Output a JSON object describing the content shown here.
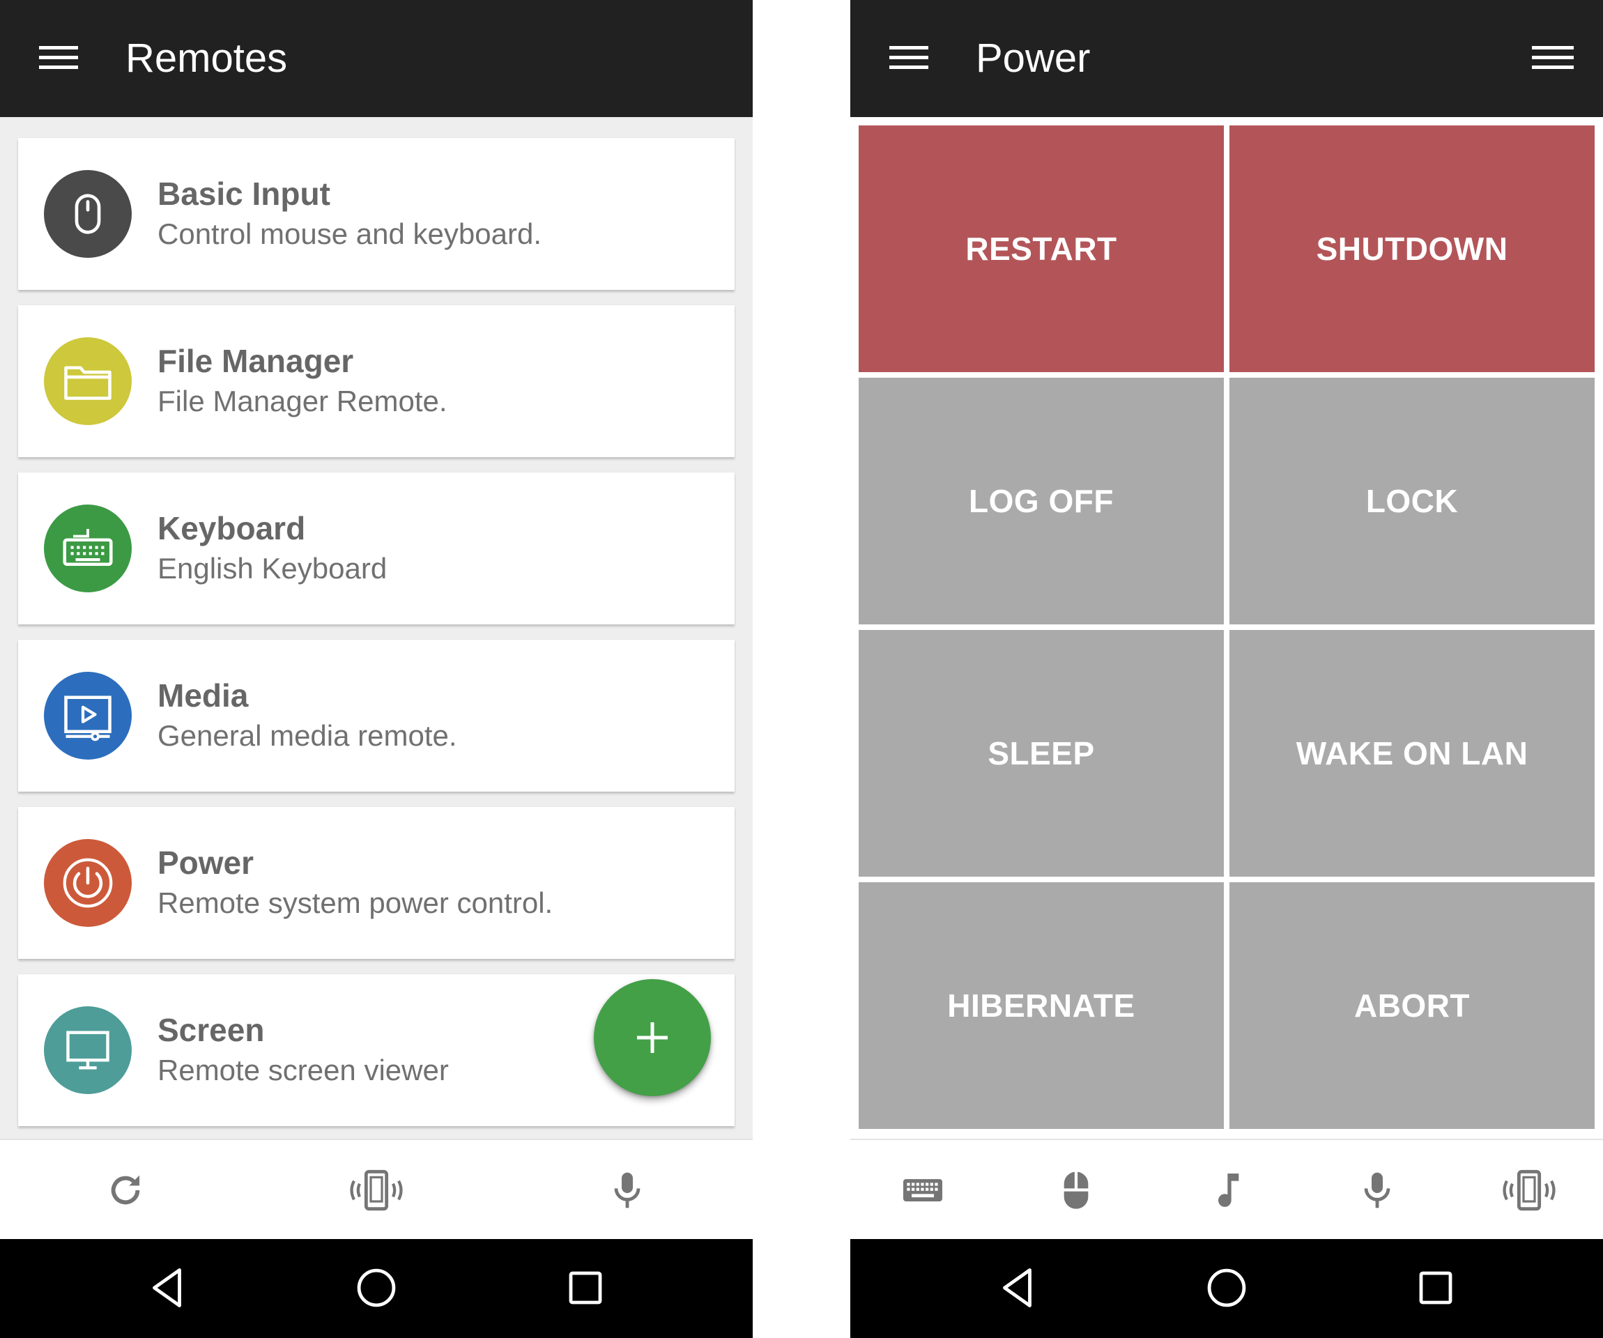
{
  "left": {
    "title": "Remotes",
    "remotes": [
      {
        "name": "Basic Input",
        "description": "Control mouse and keyboard.",
        "icon": "mouse-icon",
        "color": "#4a4a4a"
      },
      {
        "name": "File Manager",
        "description": "File Manager Remote.",
        "icon": "folder-icon",
        "color": "#cdc83c"
      },
      {
        "name": "Keyboard",
        "description": "English Keyboard",
        "icon": "keyboard-icon",
        "color": "#3c9a44"
      },
      {
        "name": "Media",
        "description": "General media remote.",
        "icon": "media-player-icon",
        "color": "#2c6ebd"
      },
      {
        "name": "Power",
        "description": "Remote system power control.",
        "icon": "power-icon",
        "color": "#cc5a3a"
      },
      {
        "name": "Screen",
        "description": "Remote screen viewer",
        "icon": "monitor-icon",
        "color": "#4e9d98"
      }
    ],
    "fab": {
      "icon": "plus-icon",
      "color": "#43a047"
    },
    "toolbar": [
      "refresh-icon",
      "vibrate-phone-icon",
      "microphone-icon"
    ]
  },
  "right": {
    "title": "Power",
    "buttons": [
      {
        "label": "RESTART",
        "color": "#b35558"
      },
      {
        "label": "SHUTDOWN",
        "color": "#b35558"
      },
      {
        "label": "LOG OFF",
        "color": "#aaaaaa"
      },
      {
        "label": "LOCK",
        "color": "#aaaaaa"
      },
      {
        "label": "SLEEP",
        "color": "#aaaaaa"
      },
      {
        "label": "WAKE ON LAN",
        "color": "#aaaaaa"
      },
      {
        "label": "HIBERNATE",
        "color": "#aaaaaa"
      },
      {
        "label": "ABORT",
        "color": "#aaaaaa"
      }
    ],
    "toolbar": [
      "keyboard-icon",
      "mouse-icon",
      "music-note-icon",
      "microphone-icon",
      "vibrate-phone-icon"
    ]
  },
  "system_nav": [
    "back-icon",
    "home-icon",
    "recents-icon"
  ],
  "colors": {
    "appbar": "#212121",
    "list_background": "#eeeeee",
    "icon_grey": "#757575"
  }
}
